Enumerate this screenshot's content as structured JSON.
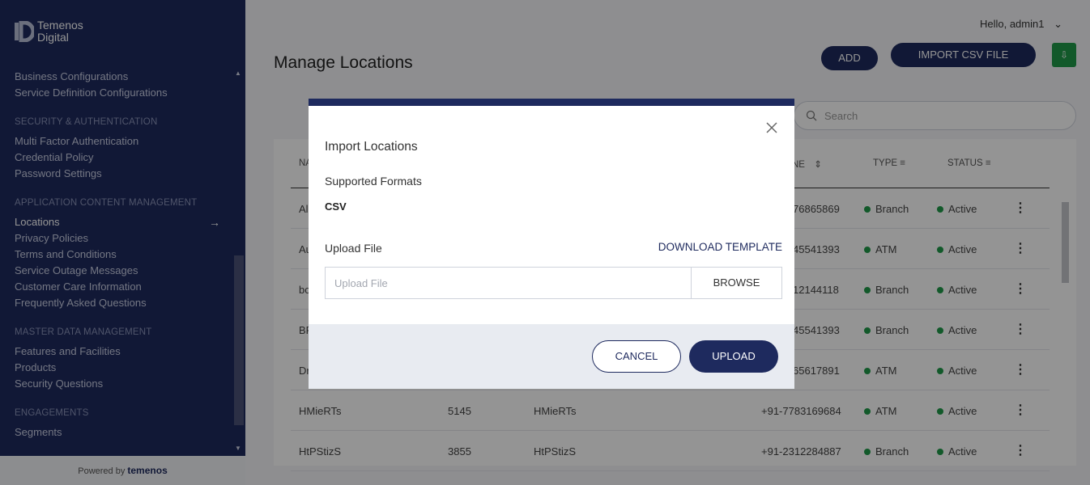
{
  "brand": {
    "line1": "Temenos",
    "line2": "Digital"
  },
  "sidebar": {
    "sections": [
      {
        "heading": "",
        "items": [
          "Business Configurations",
          "Service Definition Configurations"
        ]
      },
      {
        "heading": "SECURITY & AUTHENTICATION",
        "items": [
          "Multi Factor Authentication",
          "Credential Policy",
          "Password Settings"
        ]
      },
      {
        "heading": "APPLICATION CONTENT MANAGEMENT",
        "items": [
          "Locations",
          "Privacy Policies",
          "Terms and Conditions",
          "Service Outage Messages",
          "Customer Care Information",
          "Frequently Asked Questions"
        ]
      },
      {
        "heading": "MASTER DATA MANAGEMENT",
        "items": [
          "Features and Facilities",
          "Products",
          "Security Questions"
        ]
      },
      {
        "heading": "ENGAGEMENTS",
        "items": [
          "Segments"
        ]
      }
    ],
    "active_item": "Locations",
    "powered_prefix": "Powered by",
    "powered_brand": "temenos"
  },
  "header": {
    "greeting": "Hello, admin1",
    "page_title": "Manage Locations",
    "add_label": "ADD",
    "import_label": "IMPORT CSV FILE"
  },
  "search": {
    "placeholder": "Search"
  },
  "table": {
    "headers": {
      "name": "NA",
      "phone": "NE",
      "type": "TYPE",
      "status": "STATUS"
    },
    "rows": [
      {
        "name": "Al",
        "code": "",
        "display": "",
        "phone": "76865869",
        "type": "Branch",
        "status": "Active"
      },
      {
        "name": "Au",
        "code": "",
        "display": "",
        "phone": "45541393",
        "type": "ATM",
        "status": "Active"
      },
      {
        "name": "bc",
        "code": "",
        "display": "",
        "phone": "12144118",
        "type": "Branch",
        "status": "Active"
      },
      {
        "name": "BF",
        "code": "",
        "display": "",
        "phone": "45541393",
        "type": "Branch",
        "status": "Active"
      },
      {
        "name": "Dr",
        "code": "",
        "display": "",
        "phone": "65617891",
        "type": "ATM",
        "status": "Active"
      },
      {
        "name": "HMieRTs",
        "code": "5145",
        "display": "HMieRTs",
        "phone": "+91-7783169684",
        "type": "ATM",
        "status": "Active"
      },
      {
        "name": "HtPStizS",
        "code": "3855",
        "display": "HtPStizS",
        "phone": "+91-2312284887",
        "type": "Branch",
        "status": "Active"
      }
    ]
  },
  "modal": {
    "title": "Import Locations",
    "formats_label": "Supported Formats",
    "formats_value": "CSV",
    "upload_label": "Upload File",
    "download_template": "DOWNLOAD TEMPLATE",
    "file_placeholder": "Upload File",
    "browse_label": "BROWSE",
    "cancel_label": "CANCEL",
    "upload_button": "UPLOAD"
  },
  "colors": {
    "primary": "#1e2a5e",
    "success": "#1f9a49"
  }
}
